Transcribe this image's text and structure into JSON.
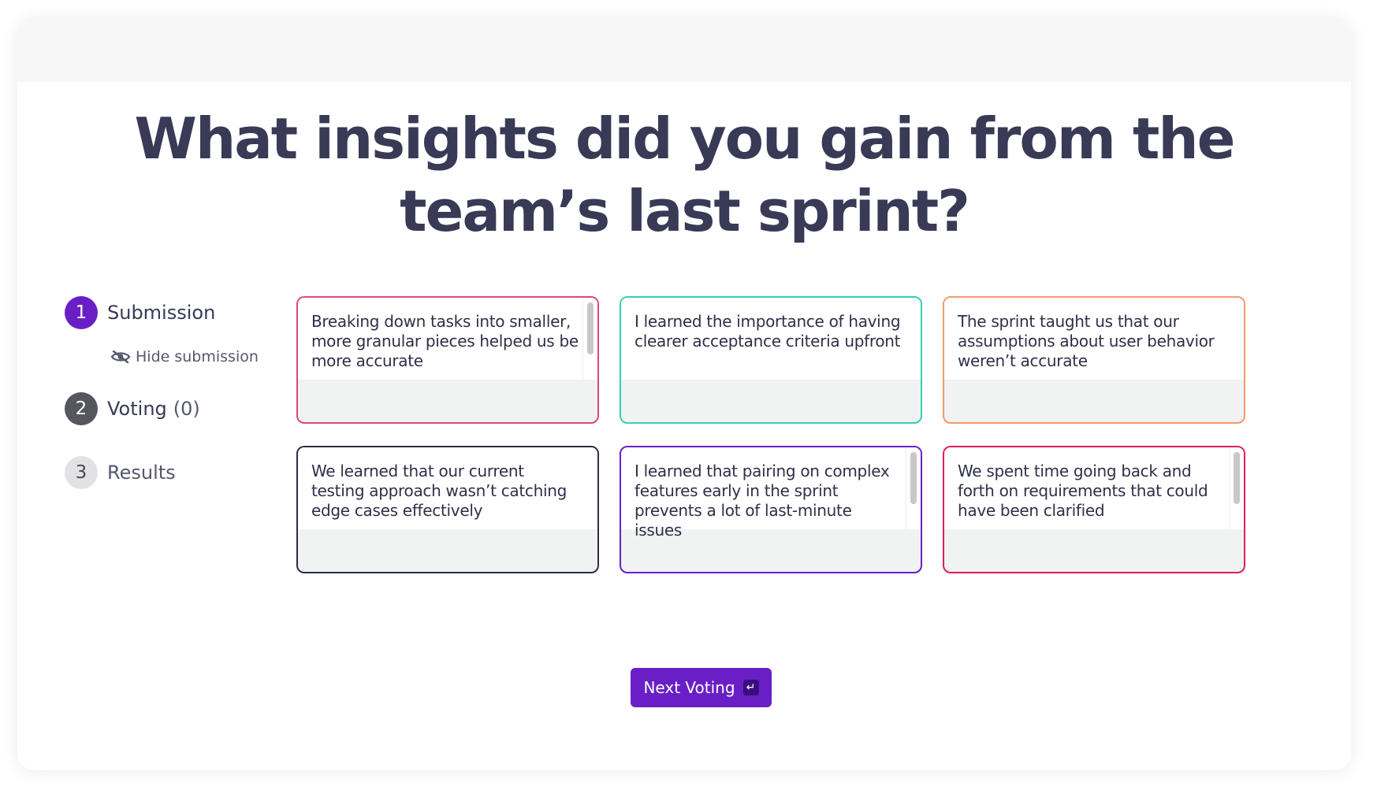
{
  "question": {
    "line1": "What insights did you gain from the",
    "line2": "team’s last sprint?"
  },
  "steps": [
    {
      "number": "1",
      "label": "Submission"
    },
    {
      "number": "2",
      "label": "Voting",
      "count": "(0)"
    },
    {
      "number": "3",
      "label": "Results"
    }
  ],
  "hide_submission": {
    "label": "Hide submission",
    "icon": "eye-off-icon"
  },
  "cards": [
    {
      "text": "Breaking down tasks into smaller, more granular pieces helped us be more accurate",
      "border_color": "#e0467c",
      "scrollbar": true
    },
    {
      "text": "I learned the importance of having clearer acceptance criteria upfront",
      "border_color": "#2fd3b2",
      "scrollbar": false
    },
    {
      "text": "The sprint taught us that our assumptions about user behavior weren’t accurate",
      "border_color": "#f29a6c",
      "scrollbar": false
    },
    {
      "text": "We learned that our current testing approach wasn’t catching edge cases effectively",
      "border_color": "#2c2d45",
      "scrollbar": false
    },
    {
      "text": "I learned that pairing on complex features early in the sprint prevents a lot of last-minute issues",
      "border_color": "#6a1fc6",
      "scrollbar": true
    },
    {
      "text": "We spent time going back and forth on requirements that could have been clarified",
      "border_color": "#e01e5a",
      "scrollbar": true
    }
  ],
  "next_button": {
    "label": "Next Voting",
    "key_icon": "↵"
  },
  "colors": {
    "accent": "#6a1fc6",
    "title": "#383a56",
    "active_step": "#6a1fc6",
    "completed_step": "#55565e",
    "pending_step": "#e2e2e4"
  }
}
